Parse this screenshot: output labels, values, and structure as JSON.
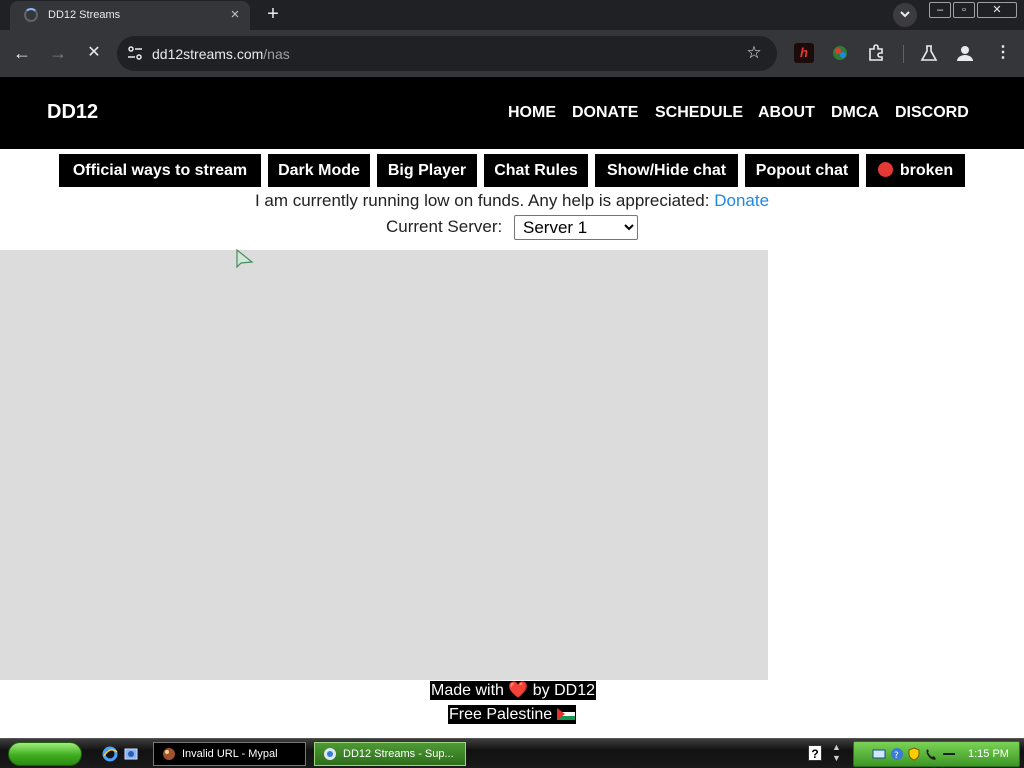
{
  "browser": {
    "tab_title": "DD12 Streams",
    "tab_close": "×",
    "new_tab": "+",
    "url_domain": "dd12streams.com",
    "url_path": "/nas",
    "window_min": "–",
    "window_max": "▫",
    "window_close": "✕",
    "ext_h_label": "h"
  },
  "site": {
    "logo": "DD12",
    "nav": [
      "HOME",
      "DONATE",
      "SCHEDULE",
      "ABOUT",
      "DMCA",
      "DISCORD"
    ],
    "buttons": [
      "Official ways to stream",
      "Dark Mode",
      "Big Player",
      "Chat Rules",
      "Show/Hide chat",
      "Popout chat",
      "broken"
    ],
    "notice_text": "I am currently running low on funds. Any help is appreciated:",
    "notice_link": "Donate",
    "server_label": "Current Server:",
    "server_selected": "Server 1",
    "footer_made_prefix": "Made with",
    "footer_made_heart": "❤️",
    "footer_made_suffix": "by DD12",
    "footer_free": "Free Palestine"
  },
  "taskbar": {
    "tasks": [
      "Invalid URL - Mypal",
      "DD12 Streams - Sup..."
    ],
    "help_glyph": "?",
    "clock": "1:15 PM"
  },
  "colors": {
    "header_bg": "#000000",
    "link": "#1e88e5",
    "player_bg": "#dcdcdc",
    "status_dot": "#e53935"
  }
}
